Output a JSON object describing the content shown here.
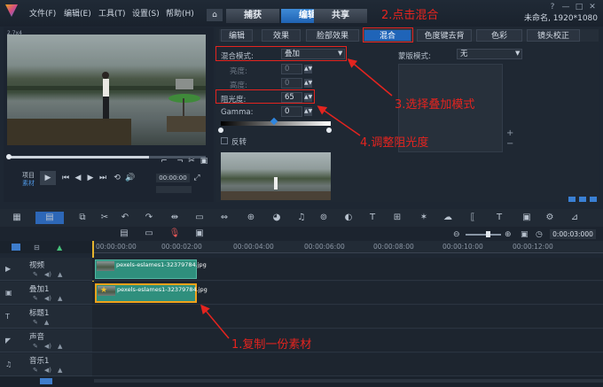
{
  "menubar": {
    "items": [
      "文件(F)",
      "编辑(E)",
      "工具(T)",
      "设置(S)",
      "帮助(H)"
    ],
    "window_controls": [
      "?",
      "—",
      "□",
      "✕"
    ],
    "project_info": "未命名, 1920*1080"
  },
  "main_tabs": {
    "home_icon": "⌂",
    "capture": "捕获",
    "edit": "编辑",
    "share": "共享"
  },
  "preview": {
    "header_label": "2.7x4",
    "project_mode": "项目",
    "clip_mode": "素材",
    "zoom_value": "00:00:00",
    "timecode_suffix": "▲",
    "buttons": {
      "play": "▶",
      "prev": "⏮",
      "step_back": "◀",
      "step_fwd": "▶",
      "next": "⏭",
      "repeat": "⟲",
      "volume": "🔊",
      "enlarge": "⤢"
    }
  },
  "options_tabs": [
    "编辑",
    "效果",
    "脸部效果",
    "混合",
    "色度键去背",
    "色彩",
    "镜头校正"
  ],
  "options": {
    "blend_mode_label": "混合模式:",
    "blend_mode_value": "叠加",
    "hue_label": "亮度:",
    "hue_value": "0",
    "saturation_label": "高度:",
    "saturation_value": "0",
    "opacity_label": "阻光度:",
    "opacity_value": "65",
    "gamma_label": "Gamma:",
    "gamma_value": "0",
    "invert_label": "反转",
    "mask_mode_label": "蒙版模式:",
    "mask_mode_value": "无",
    "add_icon": "+",
    "remove_icon": "−"
  },
  "timeline": {
    "ruler_ticks": [
      "00:00:00:00",
      "00:00:02:00",
      "00:00:04:00",
      "00:00:06:00",
      "00:00:08:00",
      "00:00:10:00",
      "00:00:12:00"
    ],
    "timecode": "0:00:03:000",
    "tracks": [
      {
        "name": "视频"
      },
      {
        "name": "叠加1"
      },
      {
        "name": "标题1"
      },
      {
        "name": "声音"
      },
      {
        "name": "音乐1"
      }
    ],
    "clips": {
      "video": "pexels-eslames1-32379784.jpg",
      "overlay": "pexels-eslames1-32379784.jpg"
    }
  },
  "annotations": {
    "step1": "1.复制一份素材",
    "step2": "2.点击混合",
    "step3": "3.选择叠加模式",
    "step4": "4.调整阻光度"
  },
  "colors": {
    "accent": "#1f64b8",
    "annotation_red": "#e4241f",
    "clip_teal": "#2f8f7d",
    "selected_clip_border": "#f0a21a"
  }
}
